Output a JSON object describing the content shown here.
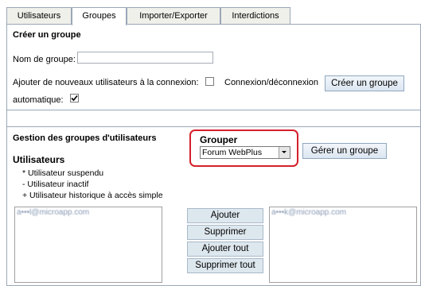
{
  "tabs": [
    {
      "label": "Utilisateurs",
      "active": false
    },
    {
      "label": "Groupes",
      "active": true
    },
    {
      "label": "Importer/Exporter",
      "active": false
    },
    {
      "label": "Interdictions",
      "active": false
    }
  ],
  "create_group": {
    "heading": "Créer un groupe",
    "name_label": "Nom de groupe:",
    "name_value": "",
    "auto_add_label": "Ajouter de nouveaux utilisateurs à la connexion:",
    "auto_add_checked": false,
    "auto_login_label_1": "Connexion/déconnexion",
    "auto_login_label_2": "automatique:",
    "auto_login_checked": true,
    "create_button": "Créer un groupe"
  },
  "manage": {
    "heading": "Gestion des groupes d'utilisateurs",
    "group_by_label": "Grouper",
    "group_select_value": "Forum WebPlus",
    "manage_button": "Gérer un groupe",
    "users_heading": "Utilisateurs",
    "legend": [
      "* Utilisateur suspendu",
      "- Utilisateur inactif",
      "+ Utilisateur historique à accès simple"
    ],
    "left_list_item": "a•••l@microapp.com",
    "right_list_item": "a•••k@microapp.com",
    "buttons": {
      "add": "Ajouter",
      "remove": "Supprimer",
      "add_all": "Ajouter tout",
      "remove_all": "Supprimer tout"
    }
  },
  "colors": {
    "highlight": "#d4202a",
    "tab_border": "#9aa7b8"
  }
}
